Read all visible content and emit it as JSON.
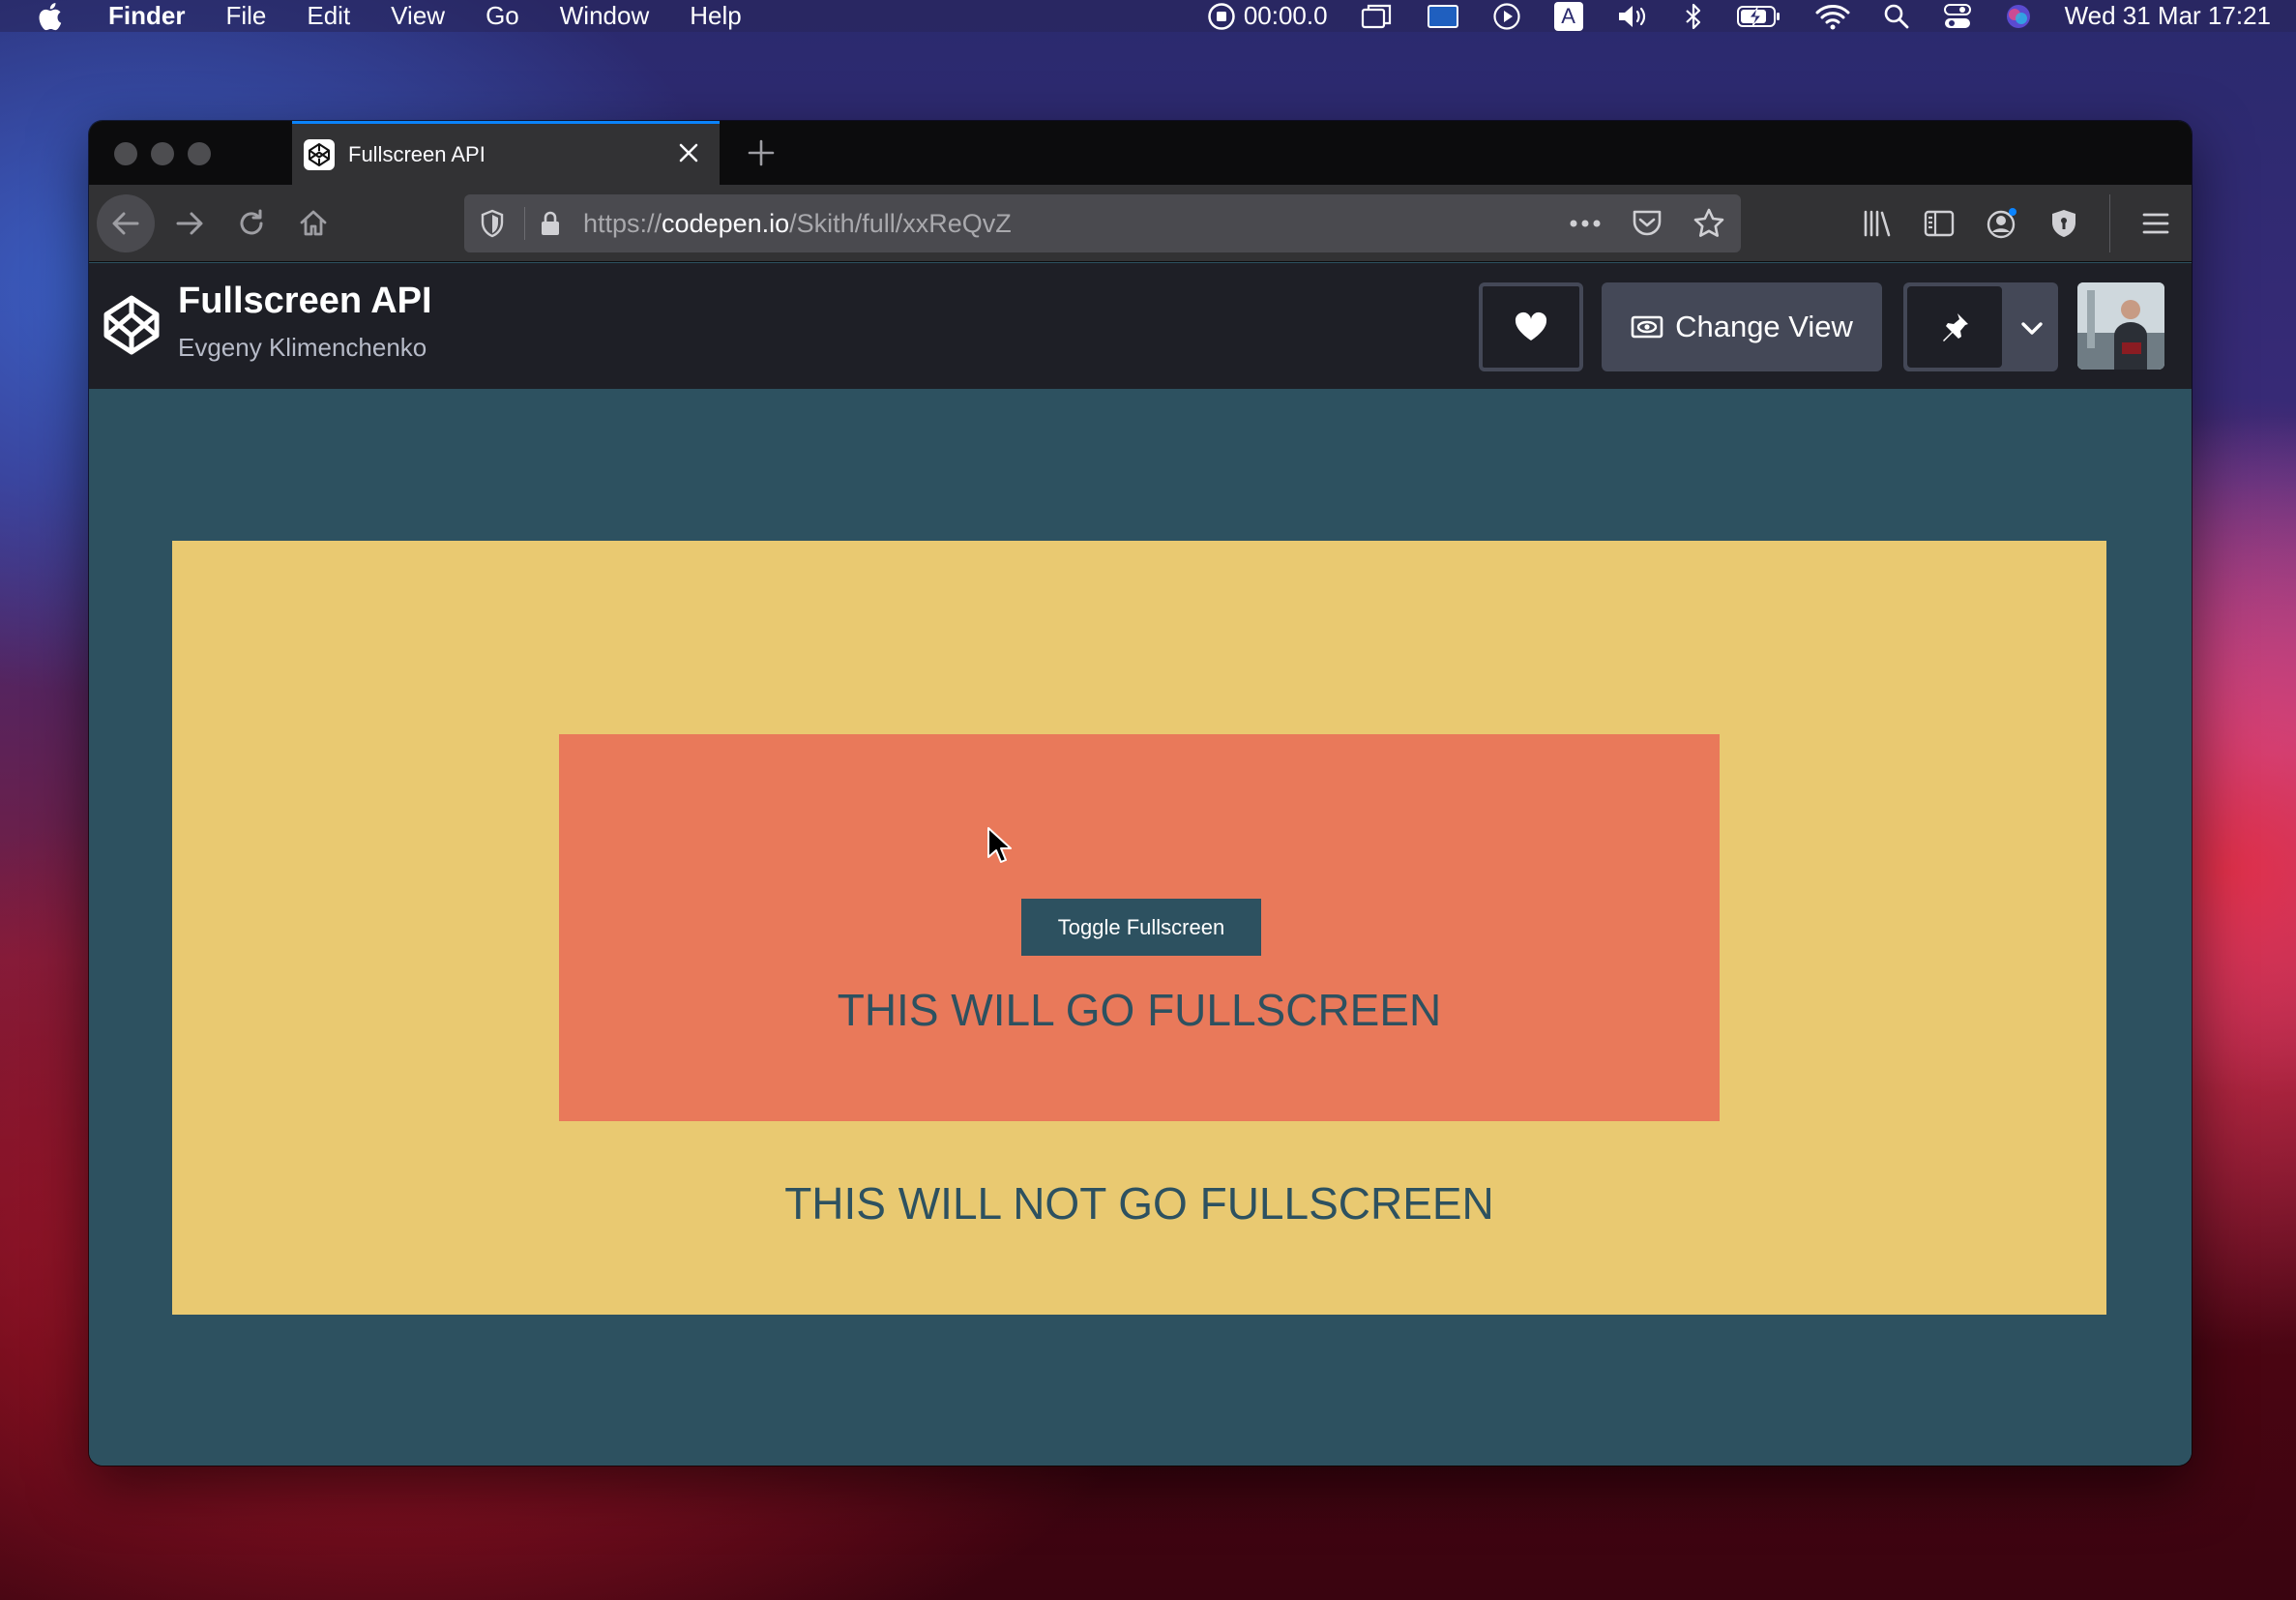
{
  "menubar": {
    "app_name": "Finder",
    "items": [
      "File",
      "Edit",
      "View",
      "Go",
      "Window",
      "Help"
    ],
    "recording_time": "00:00.0",
    "input_source": "A",
    "datetime": "Wed 31 Mar  17:21"
  },
  "browser": {
    "tab_title": "Fullscreen API",
    "url_prefix": "https://",
    "url_host": "codepen.io",
    "url_path": "/Skith/full/xxReQvZ"
  },
  "codepen": {
    "pen_title": "Fullscreen API",
    "author": "Evgeny Klimenchenko",
    "change_view_label": "Change View"
  },
  "pen": {
    "toggle_button_label": "Toggle Fullscreen",
    "fullscreen_text": "THIS WILL GO FULLSCREEN",
    "non_fullscreen_text": "THIS WILL NOT GO FULLSCREEN"
  },
  "colors": {
    "stage_bg": "#2d5160",
    "yellow_box": "#e9c971",
    "coral_box": "#e9795a",
    "codepen_header": "#1e1f26",
    "firefox_accent": "#0a84ff"
  }
}
